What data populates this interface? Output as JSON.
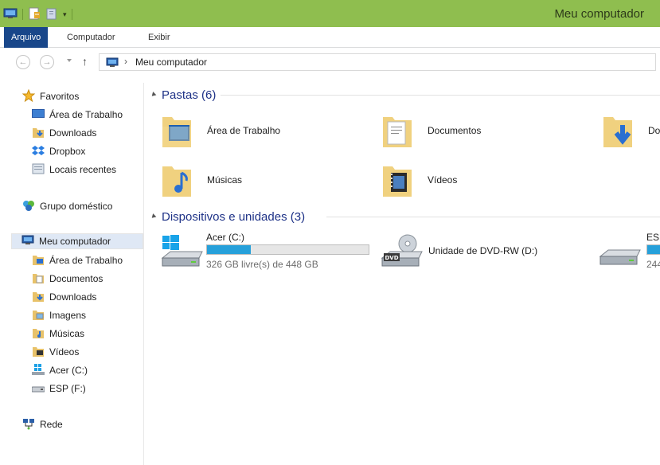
{
  "window": {
    "title": "Meu computador"
  },
  "ribbon": {
    "tabs": [
      "Arquivo",
      "Computador",
      "Exibir"
    ],
    "active_tab": "Arquivo"
  },
  "address": {
    "path_label": "Meu computador"
  },
  "sidebar": {
    "favorites_label": "Favoritos",
    "favorites": [
      "Área de Trabalho",
      "Downloads",
      "Dropbox",
      "Locais recentes"
    ],
    "homegroup_label": "Grupo doméstico",
    "computer_label": "Meu computador",
    "computer_items": [
      "Área de Trabalho",
      "Documentos",
      "Downloads",
      "Imagens",
      "Músicas",
      "Vídeos",
      "Acer (C:)",
      "ESP (F:)"
    ],
    "network_label": "Rede"
  },
  "folders_group": {
    "title": "Pastas (6)",
    "items": [
      "Área de Trabalho",
      "Documentos",
      "Do",
      "Músicas",
      "Vídeos"
    ]
  },
  "devices_group": {
    "title": "Dispositivos e unidades (3)",
    "drives": [
      {
        "name": "Acer (C:)",
        "free_text": "326 GB livre(s) de 448 GB",
        "used_fraction": 0.27
      },
      {
        "name": "Unidade de DVD-RW (D:)",
        "dvd_badge": "DVD"
      },
      {
        "name": "ESP",
        "free_text": "244",
        "used_fraction": 0.6
      }
    ]
  },
  "colors": {
    "titlebar": "#8fbe4f",
    "active_tab": "#19478a",
    "progress": "#26a0da",
    "group_title": "#1e3287"
  }
}
